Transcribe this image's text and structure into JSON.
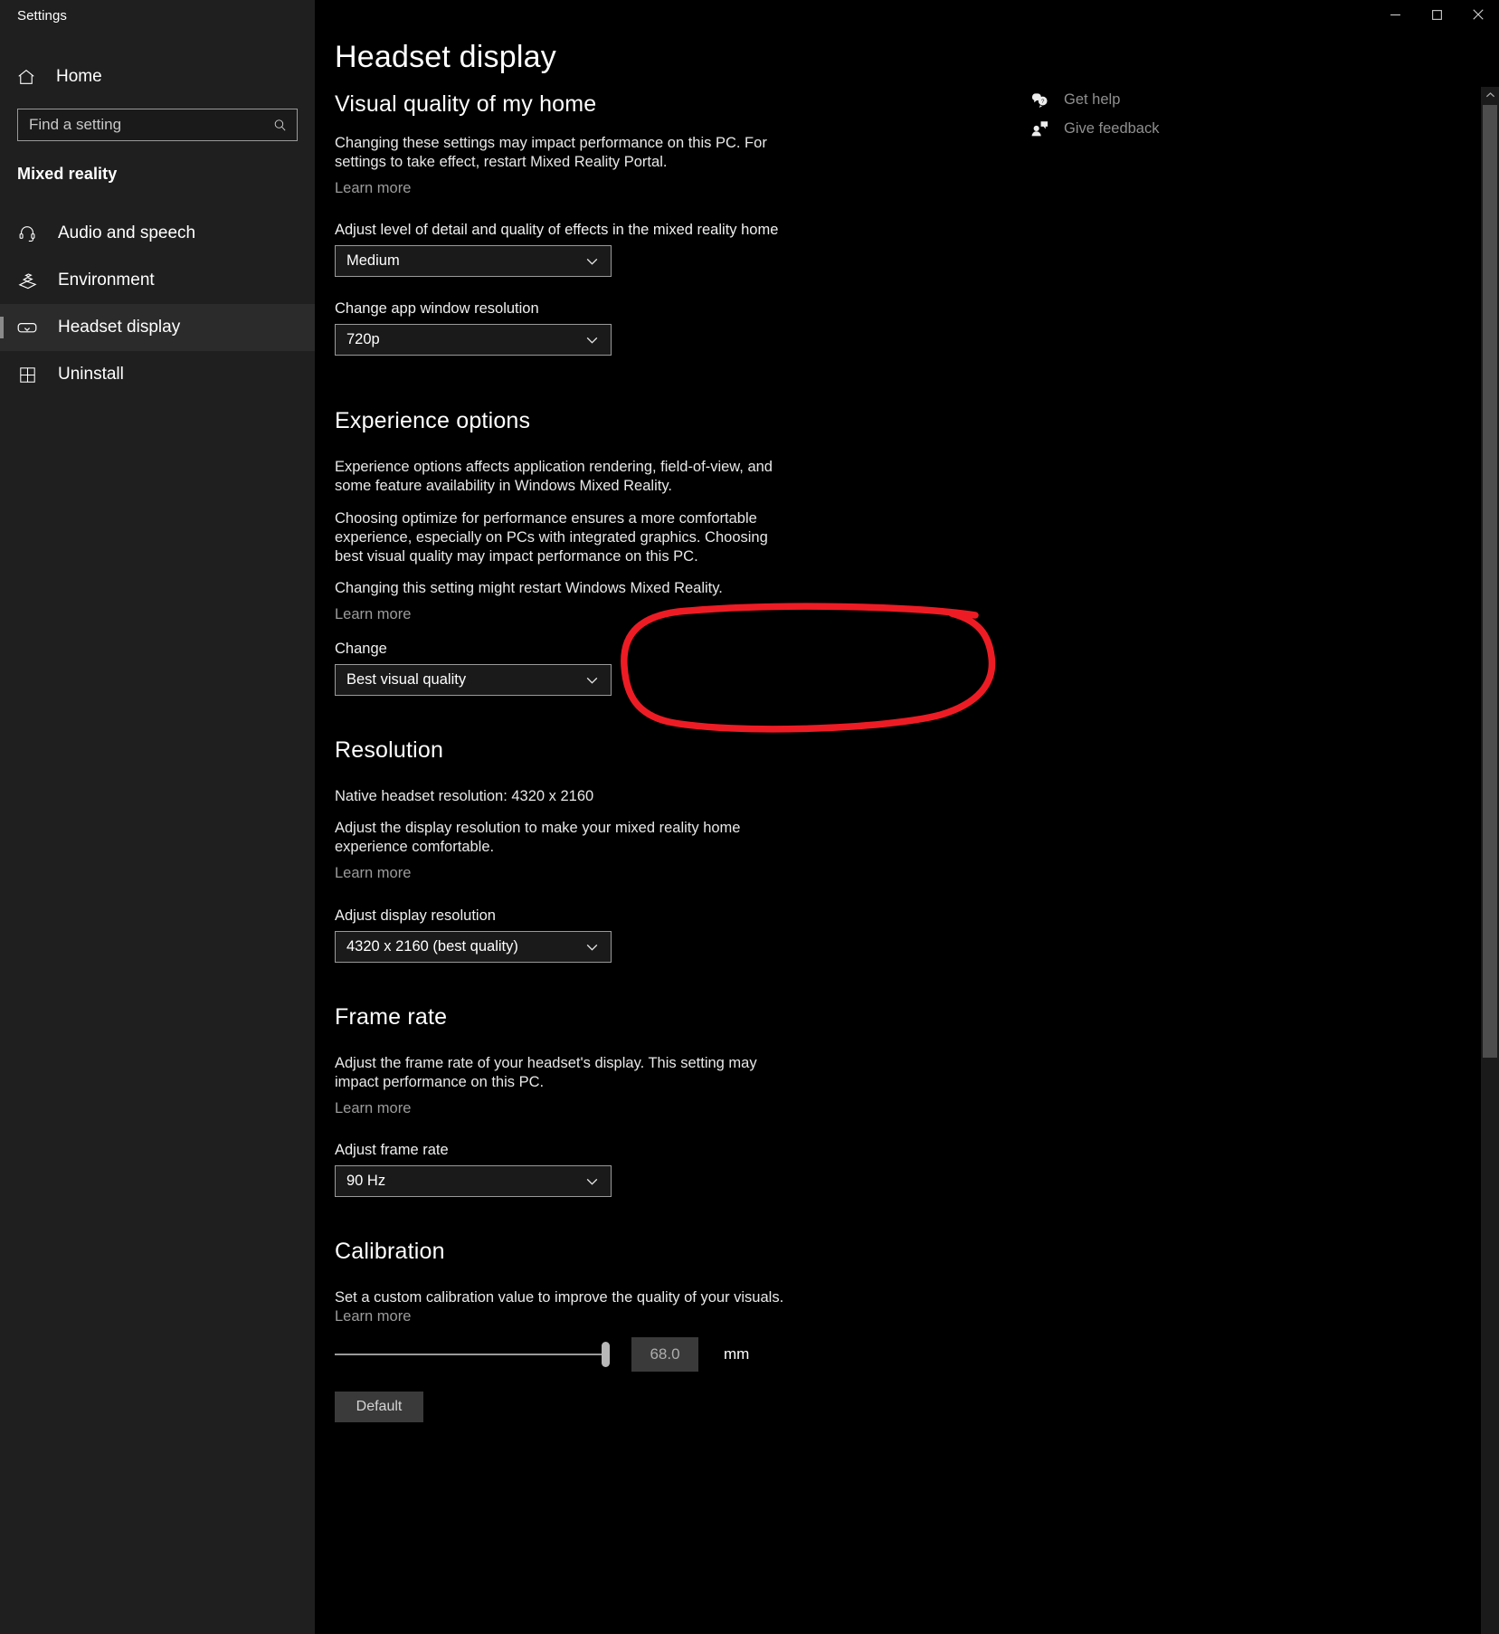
{
  "window": {
    "app_title": "Settings",
    "controls": {
      "minimize": "–",
      "maximize": "☐",
      "close": "✕"
    }
  },
  "sidebar": {
    "home_label": "Home",
    "search": {
      "placeholder": "Find a setting",
      "value": ""
    },
    "group_header": "Mixed reality",
    "items": [
      {
        "label": "Audio and speech",
        "icon": "headset-icon",
        "selected": false
      },
      {
        "label": "Environment",
        "icon": "environment-icon",
        "selected": false
      },
      {
        "label": "Headset display",
        "icon": "headset-display-icon",
        "selected": true
      },
      {
        "label": "Uninstall",
        "icon": "uninstall-icon",
        "selected": false
      }
    ]
  },
  "help_links": [
    {
      "label": "Get help",
      "icon": "question-bubble-icon"
    },
    {
      "label": "Give feedback",
      "icon": "feedback-person-icon"
    }
  ],
  "main": {
    "page_title": "Headset display",
    "sections": {
      "visual_quality": {
        "heading": "Visual quality of my home",
        "description": "Changing these settings may impact performance on this PC. For settings to take effect, restart Mixed Reality Portal.",
        "learn_more": "Learn more",
        "detail_label": "Adjust level of detail and quality of effects in the mixed reality home",
        "detail_value": "Medium",
        "app_res_label": "Change app window resolution",
        "app_res_value": "720p"
      },
      "experience_options": {
        "heading": "Experience options",
        "paragraph1": "Experience options affects application rendering, field-of-view, and some feature availability in Windows Mixed Reality.",
        "paragraph2": "Choosing optimize for performance ensures a more comfortable experience, especially on PCs with integrated graphics. Choosing best visual quality may impact performance on this PC.",
        "paragraph3": "Changing this setting might restart Windows Mixed Reality.",
        "learn_more": "Learn more",
        "change_label": "Change",
        "change_value": "Best visual quality"
      },
      "resolution": {
        "heading": "Resolution",
        "native_line": "Native headset resolution: 4320 x 2160",
        "description": "Adjust the display resolution to make your mixed reality home experience comfortable.",
        "learn_more": "Learn more",
        "adjust_label": "Adjust display resolution",
        "adjust_value": "4320 x 2160 (best quality)"
      },
      "frame_rate": {
        "heading": "Frame rate",
        "description": "Adjust the frame rate of your headset's display. This setting may impact performance on this PC.",
        "learn_more": "Learn more",
        "adjust_label": "Adjust frame rate",
        "adjust_value": "90 Hz"
      },
      "calibration": {
        "heading": "Calibration",
        "description": "Set a custom calibration value to improve the quality of your visuals.",
        "learn_more": "Learn more",
        "slider_value": "68.0",
        "unit": "mm",
        "default_button": "Default"
      }
    }
  },
  "annotation": {
    "type": "hand-drawn-circle",
    "color": "#ed1c24",
    "targets": "Change / Best visual quality dropdown"
  }
}
